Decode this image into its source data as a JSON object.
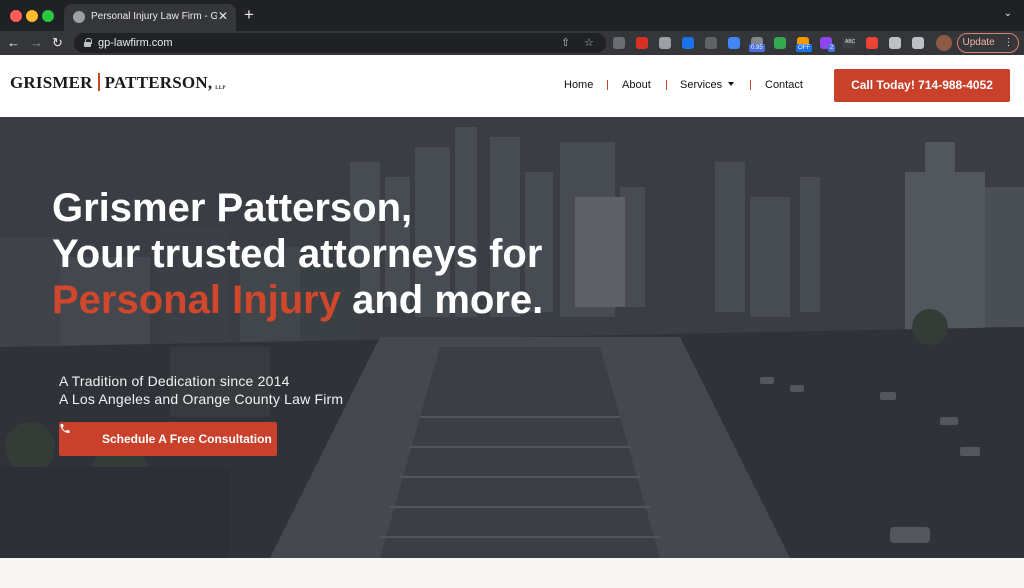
{
  "browser": {
    "tab_title": "Personal Injury Law Firm - Gris",
    "tab_close": "✕",
    "new_tab": "+",
    "tab_menu": "⌄",
    "url": "gp-lawfirm.com",
    "nav": {
      "back": "←",
      "forward": "→",
      "reload": "↻"
    },
    "omni_icons": {
      "share": "⇧",
      "bookmark": "☆"
    },
    "extensions": [
      {
        "name": "mail-extension-icon",
        "color": "#6b6f75"
      },
      {
        "name": "red-extension-icon",
        "color": "#d93025"
      },
      {
        "name": "camera-extension-icon",
        "color": "#9aa0a6"
      },
      {
        "name": "blue-check-extension-icon",
        "color": "#1a73e8"
      },
      {
        "name": "gray-extension-icon",
        "color": "#5f6368"
      },
      {
        "name": "triangle-extension-icon",
        "color": "#4285f4"
      },
      {
        "name": "counter-extension-icon",
        "color": "#80868b"
      },
      {
        "name": "sheet-extension-icon",
        "color": "#34a853"
      },
      {
        "name": "off-extension-icon",
        "color": "#f29900"
      },
      {
        "name": "purple-extension-icon",
        "color": "#8e44ef"
      },
      {
        "name": "abc-extension-icon",
        "color": "#3c4043"
      },
      {
        "name": "color-wheel-extension-icon",
        "color": "#ea4335"
      },
      {
        "name": "puzzle-extension-icon",
        "color": "#bdc1c6"
      },
      {
        "name": "sidebar-extension-icon",
        "color": "#bdc1c6"
      }
    ],
    "badges": {
      "counter": "0.95",
      "off": "OFF",
      "purple": "2",
      "abc": "ABC"
    },
    "update_label": "Update",
    "more": "⋮"
  },
  "header": {
    "logo": {
      "left": "GRISMER",
      "right": "PATTERSON,",
      "suffix": "LLP"
    },
    "nav": {
      "home": "Home",
      "about": "About",
      "services": "Services",
      "contact": "Contact"
    },
    "call_label": "Call Today! 714-988-4052"
  },
  "hero": {
    "line1": "Grismer Patterson,",
    "line2": "Your trusted attorneys for",
    "line3_accent": "Personal Injury",
    "line3_rest": " and more.",
    "tagline1": "A Tradition of Dedication since 2014",
    "tagline2": "A Los Angeles and Orange County Law Firm",
    "cta_label": "Schedule A Free Consultation"
  },
  "colors": {
    "brand_red": "#c9412a",
    "accent_text": "#d0472c",
    "chrome_dark": "#202124",
    "chrome_toolbar": "#35363a"
  }
}
